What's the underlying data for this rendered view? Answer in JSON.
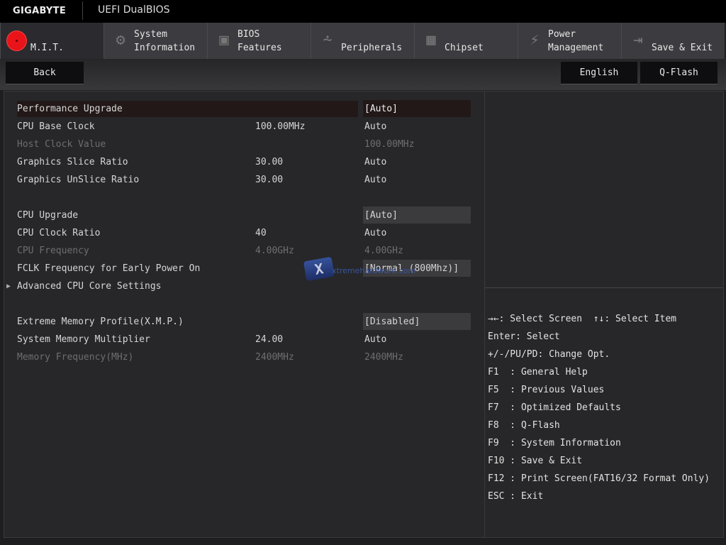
{
  "header": {
    "brand": "GIGABYTE",
    "title": "UEFI DualBIOS"
  },
  "tabs": [
    {
      "label": "M.I.T.",
      "icon": "mit-dial-icon",
      "active": true
    },
    {
      "label": "System\nInformation",
      "icon": "gear-icon"
    },
    {
      "label": "BIOS\nFeatures",
      "icon": "bios-chip-icon"
    },
    {
      "label": "Peripherals",
      "icon": "peripherals-icon"
    },
    {
      "label": "Chipset",
      "icon": "chipset-icon"
    },
    {
      "label": "Power\nManagement",
      "icon": "power-bolt-icon"
    },
    {
      "label": "Save & Exit",
      "icon": "exit-door-icon"
    }
  ],
  "toolbar": {
    "back": "Back",
    "language": "English",
    "qflash": "Q-Flash"
  },
  "settings": [
    {
      "name": "Performance Upgrade",
      "value": "",
      "setting": "[Auto]",
      "selected": true
    },
    {
      "name": "CPU Base Clock",
      "value": "100.00MHz",
      "setting": "Auto"
    },
    {
      "name": "Host Clock Value",
      "value": "",
      "setting": "100.00MHz",
      "dim": true
    },
    {
      "name": "Graphics Slice Ratio",
      "value": "30.00",
      "setting": "Auto"
    },
    {
      "name": "Graphics UnSlice Ratio",
      "value": "30.00",
      "setting": "Auto"
    },
    null,
    {
      "name": "CPU Upgrade",
      "value": "",
      "setting": "[Auto]",
      "box": true
    },
    {
      "name": "CPU Clock Ratio",
      "value": "40",
      "setting": "Auto"
    },
    {
      "name": "CPU Frequency",
      "value": "4.00GHz",
      "setting": "4.00GHz",
      "dim": true
    },
    {
      "name": "FCLK Frequency for Early Power On",
      "value": "",
      "setting": "[Normal (800Mhz)]",
      "box": true
    },
    {
      "name": "Advanced CPU Core Settings",
      "value": "",
      "setting": "",
      "submenu": true
    },
    null,
    {
      "name": "Extreme Memory Profile(X.M.P.)",
      "value": "",
      "setting": "[Disabled]",
      "box": true
    },
    {
      "name": "System Memory Multiplier",
      "value": "24.00",
      "setting": "Auto"
    },
    {
      "name": "Memory Frequency(MHz)",
      "value": "2400MHz",
      "setting": "2400MHz",
      "dim": true
    }
  ],
  "help": [
    "→←: Select Screen  ↑↓: Select Item",
    "Enter: Select",
    "+/-/PU/PD: Change Opt.",
    "F1  : General Help",
    "F5  : Previous Values",
    "F7  : Optimized Defaults",
    "F8  : Q-Flash",
    "F9  : System Information",
    "F10 : Save & Exit",
    "F12 : Print Screen(FAT16/32 Format Only)",
    "ESC : Exit"
  ],
  "watermark": "xtremehardware.com",
  "colors": {
    "mit_accent": "#e8141a",
    "selected_row": "#231818"
  }
}
